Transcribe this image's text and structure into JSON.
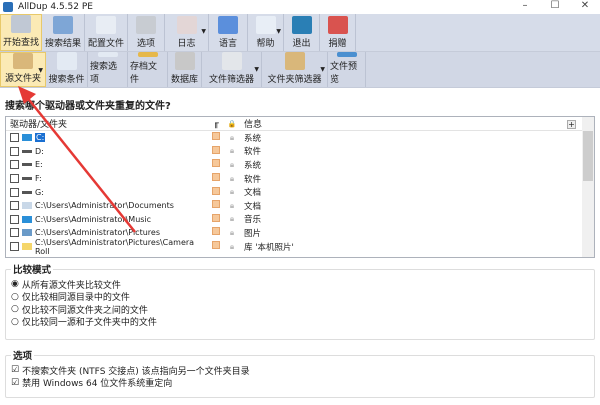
{
  "window": {
    "title": "AllDup 4.5.52 PE",
    "minimize": "–",
    "maximize": "☐",
    "close": "✕"
  },
  "toolbar1": [
    {
      "label": "开始查找",
      "icon": "magnifier-icon",
      "color": "#c0c8d4",
      "active": true
    },
    {
      "label": "搜索结果",
      "icon": "results-save-icon",
      "color": "#7ea6d6"
    },
    {
      "label": "配置文件",
      "icon": "config-file-icon",
      "color": "#e8edf4"
    },
    {
      "label": "选项",
      "icon": "options-icon",
      "color": "#c8ccd2"
    },
    {
      "label": "日志",
      "icon": "log-icon",
      "color": "#e3d6d6",
      "dropdown": true
    },
    {
      "label": "语言",
      "icon": "hello-bubble-icon",
      "color": "#5b8fdc"
    },
    {
      "label": "帮助",
      "icon": "help-icon",
      "color": "#e8eef6",
      "dropdown": true
    },
    {
      "label": "退出",
      "icon": "exit-x-icon",
      "color": "#2a7fb5"
    },
    {
      "label": "捐赠",
      "icon": "paypal-heart-icon",
      "color": "#d9534f"
    }
  ],
  "toolbar2": [
    {
      "label": "源文件夹",
      "icon": "source-folder-icon",
      "color": "#d9b77a",
      "active": true,
      "dropdown": true
    },
    {
      "label": "搜索条件",
      "icon": "search-criteria-icon",
      "color": "#e3eaf3"
    },
    {
      "label": "搜索选项",
      "icon": "search-options-icon",
      "color": "#e3eaf3"
    },
    {
      "label": "存档文件",
      "icon": "archive-icon",
      "color": "#e6b84a"
    },
    {
      "label": "数据库",
      "icon": "database-icon",
      "color": "#c8c8c8"
    },
    {
      "label": "文件筛选器",
      "icon": "file-filter-icon",
      "color": "#e3e6ea",
      "dropdown": true
    },
    {
      "label": "文件夹筛选器",
      "icon": "folder-filter-icon",
      "color": "#d9b77a",
      "dropdown": true
    },
    {
      "label": "文件预览",
      "icon": "preview-icon",
      "color": "#4a8fd0"
    }
  ],
  "heading": "搜索哪个驱动器或文件夹重复的文件?",
  "list": {
    "headers": {
      "folder": "驱动器/文件夹",
      "sub": "╓",
      "lock": "🔒",
      "info": "信息"
    },
    "add": "+",
    "rows": [
      {
        "path": "C:",
        "info": "系统",
        "selected": true,
        "icon": "system-drive-icon"
      },
      {
        "path": "D:",
        "info": "软件",
        "icon": "drive-icon"
      },
      {
        "path": "E:",
        "info": "系统",
        "icon": "drive-icon"
      },
      {
        "path": "F:",
        "info": "软件",
        "icon": "drive-icon"
      },
      {
        "path": "G:",
        "info": "文档",
        "icon": "drive-icon"
      },
      {
        "path": "C:\\Users\\Administrator\\Documents",
        "info": "文档",
        "icon": "document-icon"
      },
      {
        "path": "C:\\Users\\Administrator\\Music",
        "info": "音乐",
        "icon": "music-note-icon"
      },
      {
        "path": "C:\\Users\\Administrator\\Pictures",
        "info": "图片",
        "icon": "picture-icon"
      },
      {
        "path": "C:\\Users\\Administrator\\Pictures\\Camera Roll",
        "info": "库 '本机照片'",
        "icon": "folder-icon"
      }
    ]
  },
  "compare": {
    "title": "比较模式",
    "options": [
      "从所有源文件夹比较文件",
      "仅比较相同源目录中的文件",
      "仅比较不同源文件夹之间的文件",
      "仅比较同一源和子文件夹中的文件"
    ],
    "selected": 0
  },
  "options": {
    "title": "选项",
    "items": [
      "不搜索文件夹 (NTFS 交接点) 该点指向另一个文件夹目录",
      "禁用 Windows 64 位文件系统重定向"
    ]
  }
}
